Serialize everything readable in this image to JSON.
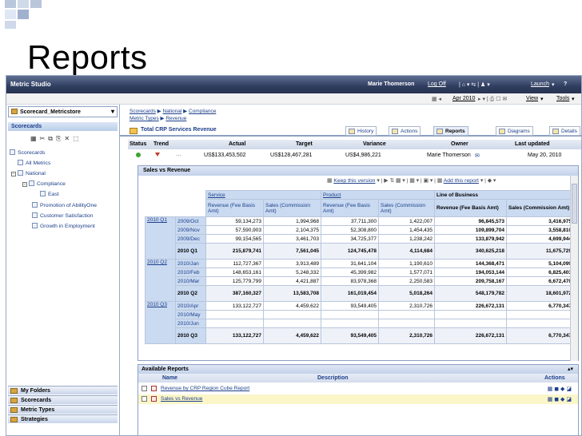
{
  "slide": {
    "title": "Reports"
  },
  "topbar": {
    "app_name": "Metric Studio",
    "user": "Marie Thomerson",
    "logoff": "Log Off",
    "launch": "Launch",
    "help": "?"
  },
  "toolrow": {
    "period": "Apr 2010",
    "view": "View",
    "tools": "Tools"
  },
  "sidebar": {
    "scorecard_selector": "Scorecard_Metricstore",
    "section_title": "Scorecards",
    "tree": [
      "Scorecards",
      "All Metrics",
      "National",
      "Compliance",
      "East",
      "Promotion of AbilityOne",
      "Customer Satisfaction",
      "Growth in Employment"
    ],
    "bottom": [
      "My Folders",
      "Scorecards",
      "Metric Types",
      "Strategies"
    ]
  },
  "breadcrumb": {
    "line1": [
      "Scorecards",
      "National",
      "Compliance"
    ],
    "line2": [
      "Metric Types",
      "Revenue"
    ]
  },
  "metric": {
    "title": "Total CRP Services Revenue"
  },
  "tabs": [
    "History",
    "Actions",
    "Reports",
    "Diagrams",
    "Details"
  ],
  "summary": {
    "headers": {
      "status": "Status",
      "trend": "Trend",
      "actual": "Actual",
      "target": "Target",
      "variance": "Variance",
      "owner": "Owner",
      "last_updated": "Last updated"
    },
    "values": {
      "actual": "US$133,453,502",
      "target": "US$128,467,281",
      "variance": "US$4,986,221",
      "owner": "Marie Thomerson",
      "last_updated": "May 20, 2010"
    }
  },
  "report": {
    "title": "Sales vs Revenue",
    "keep_version": "Keep this version",
    "add_report": "Add this report",
    "groups": {
      "service": "Service",
      "product": "Product",
      "lob": "Line of Business"
    },
    "cols": [
      "Revenue (Fee Basis Amt)",
      "Sales (Commission Amt)",
      "Revenue (Fee Basis Amt)",
      "Sales (Commission Amt)",
      "Revenue (Fee Basis Amt)",
      "Sales (Commission Amt)"
    ],
    "rows": [
      {
        "q": "2010 Q1",
        "m": "2009/Oct",
        "v": [
          "59,134,273",
          "1,994,968",
          "37,711,300",
          "1,422,007",
          "96,845,573",
          "3,416,975"
        ]
      },
      {
        "q": "",
        "m": "2009/Nov",
        "v": [
          "57,590,903",
          "2,104,375",
          "52,308,800",
          "1,454,435",
          "109,899,704",
          "3,558,810"
        ]
      },
      {
        "q": "",
        "m": "2009/Dec",
        "v": [
          "99,154,565",
          "3,461,703",
          "34,725,377",
          "1,238,242",
          "133,879,942",
          "4,699,944"
        ]
      },
      {
        "q": "",
        "m": "2010 Q1",
        "v": [
          "215,879,741",
          "7,561,045",
          "124,745,478",
          "4,114,684",
          "340,625,218",
          "11,675,729"
        ],
        "sub": true
      },
      {
        "q": "2010 Q2",
        "m": "2010/Jan",
        "v": [
          "112,727,367",
          "3,913,489",
          "31,641,104",
          "1,190,610",
          "144,368,471",
          "5,104,099"
        ]
      },
      {
        "q": "",
        "m": "2010/Feb",
        "v": [
          "148,653,161",
          "5,248,332",
          "45,399,982",
          "1,577,071",
          "194,053,144",
          "6,825,403"
        ]
      },
      {
        "q": "",
        "m": "2010/Mar",
        "v": [
          "125,779,799",
          "4,421,887",
          "83,978,368",
          "2,250,583",
          "209,758,167",
          "6,672,470"
        ]
      },
      {
        "q": "",
        "m": "2010 Q2",
        "v": [
          "387,160,327",
          "13,583,708",
          "161,019,454",
          "5,018,264",
          "548,179,782",
          "18,601,972"
        ],
        "sub": true
      },
      {
        "q": "2010 Q3",
        "m": "2010/Apr",
        "v": [
          "133,122,727",
          "4,459,622",
          "93,549,405",
          "2,310,726",
          "226,672,131",
          "6,770,347"
        ]
      },
      {
        "q": "",
        "m": "2010/May",
        "v": [
          "",
          "",
          "",
          "",
          "",
          ""
        ]
      },
      {
        "q": "",
        "m": "2010/Jun",
        "v": [
          "",
          "",
          "",
          "",
          "",
          ""
        ]
      },
      {
        "q": "",
        "m": "2010 Q3",
        "v": [
          "133,122,727",
          "4,459,622",
          "93,549,405",
          "2,310,726",
          "226,672,131",
          "6,770,347"
        ],
        "sub": true
      }
    ]
  },
  "available": {
    "title": "Available Reports",
    "cols": {
      "name": "Name",
      "description": "Description",
      "actions": "Actions"
    },
    "rows": [
      "Revenue by CRP Region Cube Report",
      "Sales vs Revenue"
    ]
  }
}
